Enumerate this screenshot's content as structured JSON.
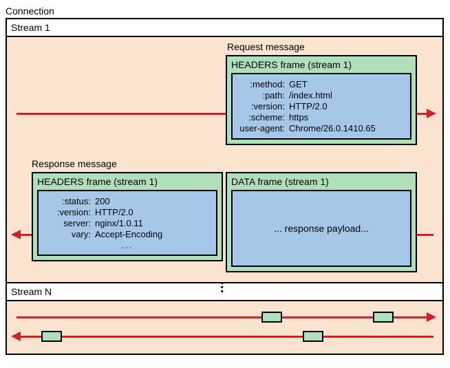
{
  "title": "Connection",
  "stream1": {
    "header": "Stream 1",
    "request": {
      "label": "Request message",
      "frame_title": "HEADERS frame (stream 1)",
      "headers": [
        {
          "k": ":method:",
          "v": "GET"
        },
        {
          "k": ":path:",
          "v": "/index.html"
        },
        {
          "k": ":version:",
          "v": "HTTP/2.0"
        },
        {
          "k": ":scheme:",
          "v": "https"
        },
        {
          "k": "user-agent:",
          "v": "Chrome/26.0.1410.65"
        }
      ]
    },
    "response": {
      "label": "Response message",
      "headers_frame": {
        "title": "HEADERS frame (stream 1)",
        "headers": [
          {
            "k": ":status:",
            "v": "200"
          },
          {
            "k": ":version:",
            "v": "HTTP/2.0"
          },
          {
            "k": "server:",
            "v": "nginx/1.0.11"
          },
          {
            "k": "vary:",
            "v": "Accept-Encoding"
          }
        ],
        "ellipsis": "..."
      },
      "data_frame": {
        "title": "DATA frame (stream 1)",
        "body": "... response payload..."
      }
    }
  },
  "streamN": {
    "header": "Stream N"
  }
}
